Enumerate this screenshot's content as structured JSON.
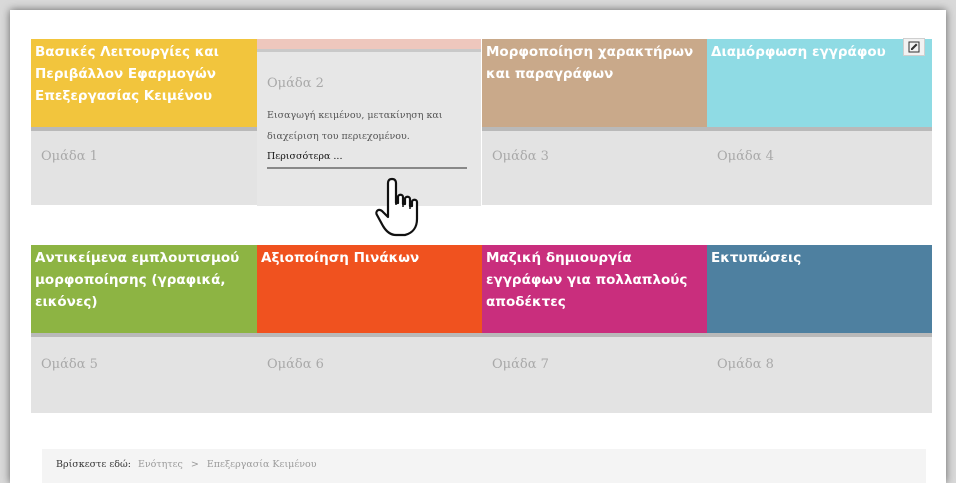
{
  "tiles": [
    {
      "title": "Βασικές Λειτουργίες και Περιβάλλον Εφαρμογών Επεξεργασίας Κειμένου",
      "group": "Ομάδα 1",
      "color": "#f2c53d"
    },
    {
      "title": "",
      "group": "",
      "color": "#eec7bd"
    },
    {
      "title": "Μορφοποίηση χαρακτήρων και παραγράφων",
      "group": "Ομάδα 3",
      "color": "#c9a98a"
    },
    {
      "title": "Διαμόρφωση εγγράφου",
      "group": "Ομάδα 4",
      "color": "#8fdbe4"
    },
    {
      "title": "Αντικείμενα εμπλουτισμού μορφοποίησης (γραφικά, εικόνες)",
      "group": "Ομάδα 5",
      "color": "#8db443"
    },
    {
      "title": "Αξιοποίηση Πινάκων",
      "group": "Ομάδα 6",
      "color": "#f0521f"
    },
    {
      "title": "Μαζική δημιουργία εγγράφων για πολλαπλούς αποδέκτες",
      "group": "Ομάδα 7",
      "color": "#c92e7d"
    },
    {
      "title": "Εκτυπώσεις",
      "group": "Ομάδα 8",
      "color": "#4e80a0"
    }
  ],
  "hover_card": {
    "group": "Ομάδα 2",
    "description": "Εισαγωγή κειμένου, μετακίνηση και διαχείριση του περιεχομένου.",
    "more_link": "Περισσότερα ..."
  },
  "edit_icon": "edit-icon",
  "cursor_icon": "hand-pointer-icon",
  "breadcrumb": {
    "label": "Βρίσκεστε εδώ:",
    "items": [
      "Ενότητες",
      "Επεξεργασία Κειμένου"
    ],
    "separator": ">"
  }
}
